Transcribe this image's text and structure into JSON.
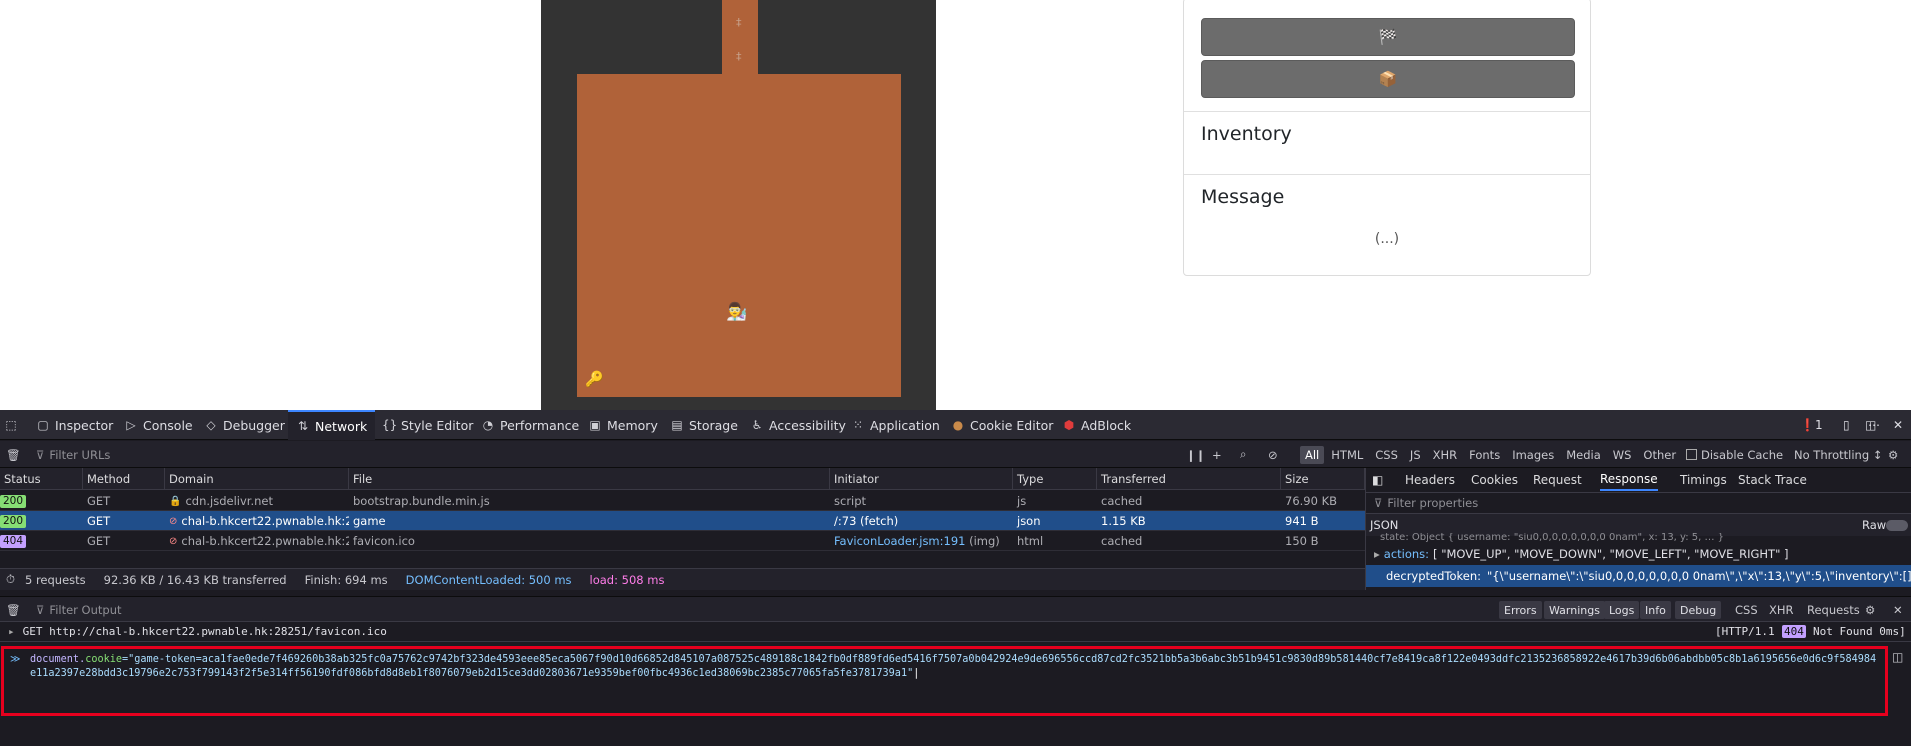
{
  "page": {
    "game": {
      "corridor_symbols": [
        "‡",
        "‡"
      ],
      "player_icon": "person-icon",
      "player_glyph": "👨‍🔬",
      "key_icon": "key-icon",
      "key_glyph": "🔑",
      "colors": {
        "wall": "#333333",
        "floor": "#b06239"
      }
    },
    "sidebar": {
      "buttons": [
        {
          "icon": "checkered-flag-icon",
          "glyph": "🏁"
        },
        {
          "icon": "package-icon",
          "glyph": "📦"
        }
      ],
      "inventory_title": "Inventory",
      "message_title": "Message",
      "message_text": "(...)"
    }
  },
  "devtools": {
    "tabs": [
      "Inspector",
      "Console",
      "Debugger",
      "Network",
      "Style Editor",
      "Performance",
      "Memory",
      "Storage",
      "Accessibility",
      "Application",
      "Cookie Editor",
      "AdBlock"
    ],
    "active_tab": "Network",
    "error_count": "1",
    "network": {
      "filter_placeholder": "Filter URLs",
      "type_filters": [
        "All",
        "HTML",
        "CSS",
        "JS",
        "XHR",
        "Fonts",
        "Images",
        "Media",
        "WS",
        "Other"
      ],
      "disable_cache_label": "Disable Cache",
      "throttling_label": "No Throttling ↕",
      "columns": [
        "Status",
        "Method",
        "Domain",
        "File",
        "Initiator",
        "Type",
        "Transferred",
        "Size"
      ],
      "rows": [
        {
          "status": "200",
          "method": "GET",
          "domain": "cdn.jsdelivr.net",
          "file": "bootstrap.bundle.min.js",
          "initiator": "script",
          "type": "js",
          "transferred": "cached",
          "size": "76.90 KB"
        },
        {
          "status": "200",
          "method": "GET",
          "domain": "chal-b.hkcert22.pwnable.hk:2...",
          "file": "game",
          "initiator": "/:73 (fetch)",
          "type": "json",
          "transferred": "1.15 KB",
          "size": "941 B"
        },
        {
          "status": "404",
          "method": "GET",
          "domain": "chal-b.hkcert22.pwnable.hk:2...",
          "file": "favicon.ico",
          "initiator": "FaviconLoader.jsm:191",
          "initiator_suffix": " (img)",
          "type": "html",
          "transferred": "cached",
          "size": "150 B"
        }
      ],
      "summary": {
        "requests": "5 requests",
        "transferred": "92.36 KB / 16.43 KB transferred",
        "finish": "Finish: 694 ms",
        "dom_loaded": "DOMContentLoaded: 500 ms",
        "load": "load: 508 ms"
      },
      "panel_tabs": [
        "Headers",
        "Cookies",
        "Request",
        "Response",
        "Timings",
        "Stack Trace"
      ],
      "active_panel_tab": "Response",
      "filter_properties_placeholder": "Filter properties",
      "json_label": "JSON",
      "raw_label": "Raw",
      "response_lines": {
        "state_partial": "state: Object { username: \"siu0,0,0,0,0,0,0,0 0nam\", x: 13, y: 5, … }",
        "actions_key": "actions:",
        "actions_value": "[ \"MOVE_UP\", \"MOVE_DOWN\", \"MOVE_LEFT\", \"MOVE_RIGHT\" ]",
        "token_key": "decryptedToken:",
        "token_value": "\"{\\\"username\\\":\\\"siu0,0,0,0,0,0,0,0 0nam\\\",\\\"x\\\":13,\\\"y\\\":5,\\\"inventory\\\":[],\\\"onMapItems"
      }
    },
    "console": {
      "filter_placeholder": "Filter Output",
      "levels": [
        "Errors",
        "Warnings",
        "Logs",
        "Info",
        "Debug"
      ],
      "categories": [
        "CSS",
        "XHR",
        "Requests"
      ],
      "log_request": "GET http://chal-b.hkcert22.pwnable.hk:28251/favicon.ico",
      "log_protocol": "[HTTP/1.1",
      "log_status": "404",
      "log_result": "Not Found 0ms]",
      "input_prefix": "document.",
      "input_prop": "cookie",
      "input_eq": "=",
      "input_value": "\"game-token=aca1fae0ede7f469260b38ab325fc0a75762c9742bf323de4593eee85eca5067f90d10d66852d845107a087525c489188c1842fb0df889fd6ed5416f7507a0b042924e9de696556ccd87cd2fc3521bb5a3b6abc3b51b9451c9830d89b581440cf7e8419ca8f122e0493ddfc2135236858922e4617b39d6b06abdbb05c8b1a6195656e0d6c9f584984e11a2397e28bdd3c19796e2c753f799143f2f5e314ff56190fdf086bfd8d8eb1f8076079eb2d15ce3dd02803671e9359bef00fbc4936c1ed38069bc2385c77065fa5fe3781739a1\""
    }
  }
}
